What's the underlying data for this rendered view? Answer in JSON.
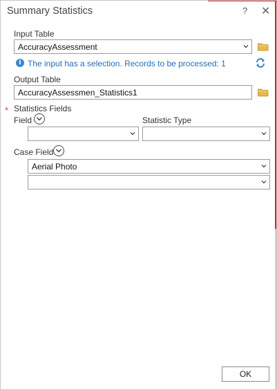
{
  "dialog": {
    "title": "Summary Statistics",
    "help_label": "?",
    "close_label": "✕"
  },
  "input_table": {
    "label": "Input Table",
    "value": "AccuracyAssessment"
  },
  "info": {
    "message": "The input has a selection. Records to be processed: 1",
    "icon_glyph": "i"
  },
  "output_table": {
    "label": "Output Table",
    "value": "AccuracyAssessmen_Statistics1"
  },
  "statistics_fields": {
    "required_marker": "*",
    "label": "Statistics Fields",
    "field_label": "Field",
    "statistic_type_label": "Statistic Type",
    "field_value": "",
    "statistic_type_value": ""
  },
  "case_field": {
    "label": "Case Field",
    "rows": [
      "Aerial Photo",
      ""
    ]
  },
  "footer": {
    "ok_label": "OK"
  },
  "colors": {
    "accent_red": "#e0261e",
    "info_blue": "#1f6db8",
    "folder_yellow": "#e8b84a",
    "required_orange": "#d0482e"
  }
}
